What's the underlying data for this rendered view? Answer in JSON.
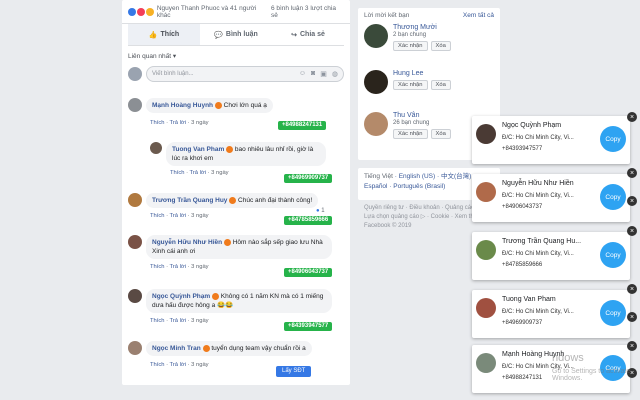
{
  "post": {
    "reactors_text": "Nguyen Thanh Phuoc và 41 người khác",
    "stats": "6 bình luận  3 lượt chia sẻ",
    "actions": [
      "Thích",
      "Bình luận",
      "Chia sẻ"
    ],
    "sort_label": "Liên quan nhất ▾",
    "composer_placeholder": "Viết bình luận..."
  },
  "comments": [
    {
      "name": "Mạnh Hoàng Huynh",
      "text": "Chơi lớn quá ạ",
      "like": "Thích",
      "reply": "Trả lời",
      "time": "3 ngày",
      "phone": "+84988247131"
    },
    {
      "name": "Tuong Van Pham",
      "text": "bao nhiêu lâu nhỉ rồi, giờ là lúc ra khơi em",
      "like": "Thích",
      "reply": "Trả lời",
      "time": "3 ngày",
      "phone": "+84969909737"
    },
    {
      "name": "Trương Trần Quang Huy",
      "text": "Chúc anh đại thành công!",
      "like": "Thích",
      "reply": "Trả lời",
      "time": "3 ngày",
      "phone": "+84785859666",
      "count": "1"
    },
    {
      "name": "Nguyễn Hữu Như Hiền",
      "text": "Hôm nào sắp sếp giao lưu Nhà Xinh cái anh ơi",
      "like": "Thích",
      "reply": "Trả lời",
      "time": "3 ngày",
      "phone": "+84906043737"
    },
    {
      "name": "Ngọc Quỳnh Phạm",
      "text": "Không có 1 năm KN mà có 1 miếng dưa hấu được hông a 😂😂",
      "like": "Thích",
      "reply": "Trả lời",
      "time": "3 ngày",
      "phone": "+84393947577"
    },
    {
      "name": "Ngọc Minh Tran",
      "text": "tuyển dụng team vậy chuẩn rồi a",
      "like": "Thích",
      "reply": "Trả lời",
      "time": "3 ngày",
      "button": "Lấy SĐT"
    }
  ],
  "friend_requests": {
    "title": "Lời mời kết bạn",
    "see_all": "Xem tất cả",
    "items": [
      {
        "name": "Thương Mười",
        "mutual": "2 bạn chung",
        "confirm": "Xác nhận",
        "delete": "Xóa"
      },
      {
        "name": "Hung Lee",
        "mutual": "",
        "confirm": "Xác nhận",
        "delete": "Xóa"
      },
      {
        "name": "Thu Vân",
        "mutual": "26 bạn chung",
        "confirm": "Xác nhận",
        "delete": "Xóa"
      }
    ]
  },
  "languages": {
    "line1": [
      "Tiếng Việt",
      "English (US)",
      "中文(台灣)"
    ],
    "line2": [
      "Español",
      "Português (Brasil)"
    ]
  },
  "footer": {
    "line1": "Quyền riêng tư · Điều khoản · Quảng cáo",
    "line2": "Lựa chọn quảng cáo ▷ · Cookie · Xem thêm ·",
    "line3": "Facebook © 2019"
  },
  "extension_cards": [
    {
      "name": "Ngọc Quỳnh Phạm",
      "address": "Đ/C: Ho Chi Minh City, Vi...",
      "phone": "+84393947577",
      "copy": "Copy"
    },
    {
      "name": "Nguyễn Hữu Như Hiền",
      "address": "Đ/C: Ho Chi Minh City, Vi...",
      "phone": "+84906043737",
      "copy": "Copy"
    },
    {
      "name": "Trương Trần Quang Hu...",
      "address": "Đ/C: Ho Chi Minh City, Vi...",
      "phone": "+84785859666",
      "copy": "Copy"
    },
    {
      "name": "Tuong Van Pham",
      "address": "Đ/C: Ho Chi Minh City, Vi...",
      "phone": "+84969909737",
      "copy": "Copy"
    },
    {
      "name": "Mạnh Hoàng Huynh",
      "address": "Đ/C: Ho Chi Minh City, Vi...",
      "phone": "+84988247131",
      "copy": "Copy"
    }
  ],
  "watermark": {
    "line1": "ndows",
    "line2": "Go to Settings to activate Windows."
  },
  "colors": {
    "fb_link": "#385898",
    "phone_green": "#26b34a",
    "copy_blue": "#2ea3f2",
    "like_blue": "#3578e5"
  }
}
